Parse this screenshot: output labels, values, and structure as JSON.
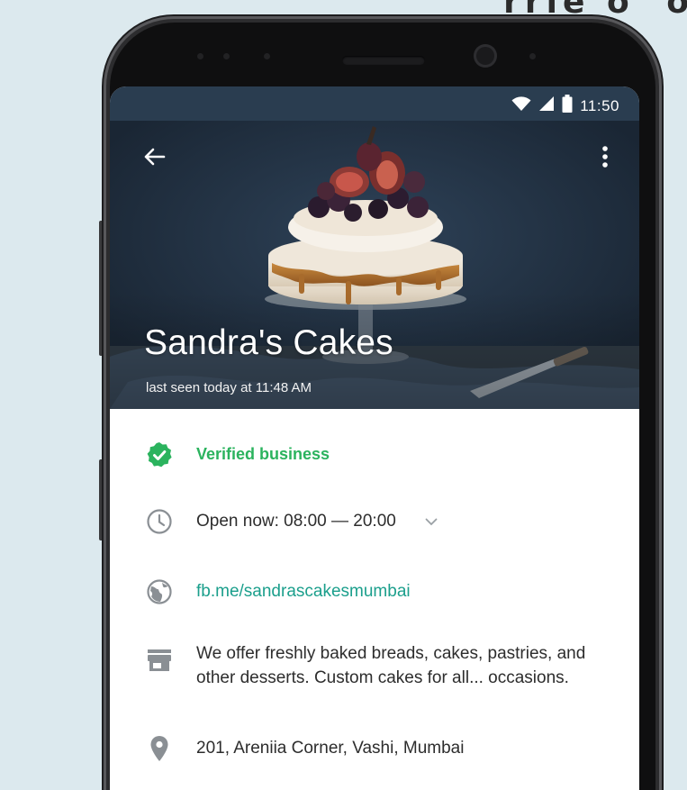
{
  "corner_text": "rrie o' o",
  "status_bar": {
    "time": "11:50",
    "icons": [
      "wifi-icon",
      "signal-icon",
      "battery-icon"
    ]
  },
  "header": {
    "back_icon": "arrow-left-icon",
    "menu_icon": "more-vert-icon",
    "business_name": "Sandra's Cakes",
    "last_seen": "last seen today at 11:48 AM"
  },
  "info": {
    "verified": {
      "icon": "verified-badge-icon",
      "label": "Verified business",
      "color": "#2bb35e"
    },
    "hours": {
      "icon": "clock-icon",
      "label": "Open now: 08:00 — 20:00",
      "expand_icon": "chevron-down-icon"
    },
    "website": {
      "icon": "globe-icon",
      "label": "fb.me/sandrascakesmumbai",
      "color": "#1b9f8c"
    },
    "description": {
      "icon": "store-icon",
      "line1": "We offer freshly baked breads, cakes, pastries, and",
      "line2": "other desserts. Custom cakes for all... occasions."
    },
    "address": {
      "icon": "location-pin-icon",
      "label": "201, Areniia Corner, Vashi, Mumbai"
    }
  },
  "colors": {
    "status_bar": "#2a3d50",
    "background": "#dce9ee",
    "icon_gray": "#8a8f94"
  }
}
